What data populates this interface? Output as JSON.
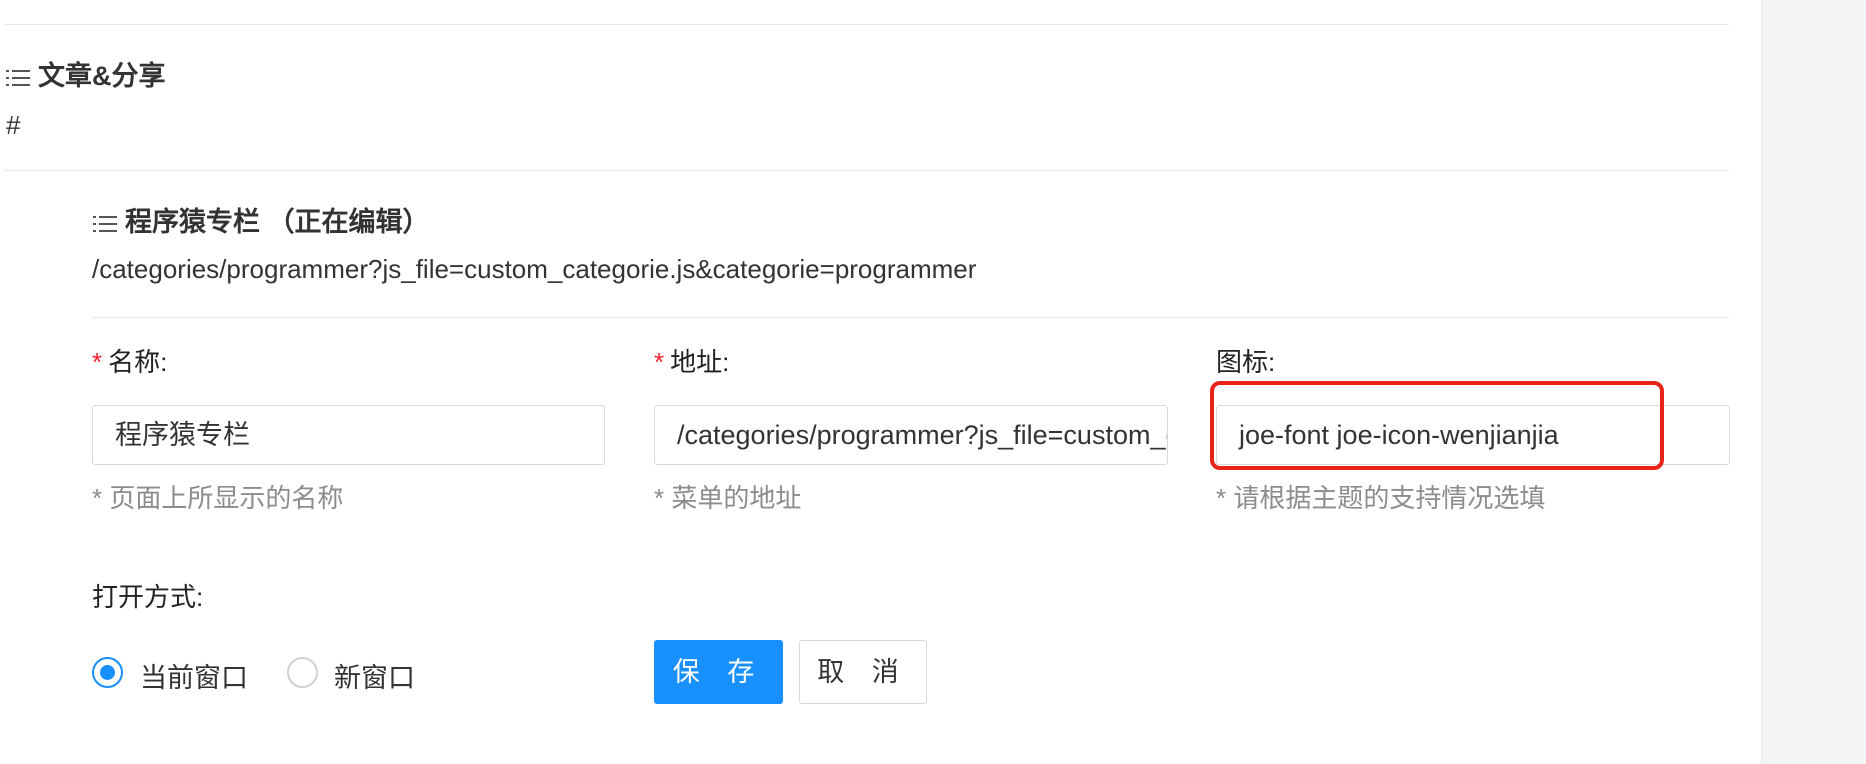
{
  "menu_items": [
    {
      "title": "文章&分享",
      "url": "#"
    },
    {
      "title": "程序猿专栏 （正在编辑）",
      "url": "/categories/programmer?js_file=custom_categorie.js&categorie=programmer"
    }
  ],
  "form": {
    "name": {
      "required_mark": "*",
      "label": "名称:",
      "value": "程序猿专栏",
      "help": "* 页面上所显示的名称"
    },
    "url": {
      "required_mark": "*",
      "label": "地址:",
      "value": "/categories/programmer?js_file=custom_categorie.js&categorie=programmer",
      "help": "* 菜单的地址"
    },
    "icon": {
      "label": "图标:",
      "value": "joe-font joe-icon-wenjianjia",
      "help": "* 请根据主题的支持情况选填"
    },
    "open_mode": {
      "label": "打开方式:",
      "options": [
        {
          "label": "当前窗口",
          "checked": true
        },
        {
          "label": "新窗口",
          "checked": false
        }
      ]
    },
    "save_label": "保 存",
    "cancel_label": "取 消"
  },
  "colors": {
    "accent": "#1890ff",
    "required": "#f5222d",
    "highlight": "#e8231a",
    "help_text": "#8c8c8c"
  },
  "icons": [
    "list-icon"
  ]
}
